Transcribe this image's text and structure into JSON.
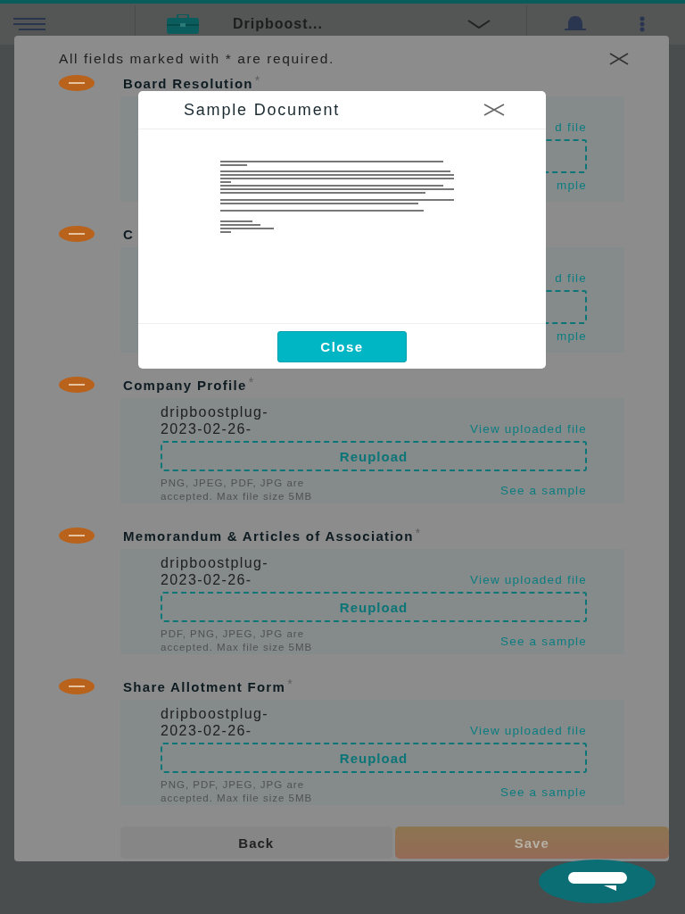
{
  "header": {
    "company": "Dripboost..."
  },
  "form": {
    "notice": "All fields marked with * are required.",
    "sections": [
      {
        "title": "Board Resolution",
        "expanded": true,
        "required_mark": "*",
        "view_link": "d file",
        "sample_link": "mple"
      },
      {
        "title": "C",
        "expanded": true,
        "view_link": "d file",
        "sample_link": "mple"
      },
      {
        "title": "Company Profile",
        "expanded": true,
        "required_mark": "*",
        "file_name_lines": [
          "dripboostplug-",
          "2023-02-26-"
        ],
        "view_link": "View uploaded file",
        "reupload_label": "Reupload",
        "formats": "PNG, JPEG, PDF, JPG are accepted. Max file size 5MB",
        "sample_link": "See a sample"
      },
      {
        "title": "Memorandum & Articles of Association",
        "expanded": true,
        "required_mark": "*",
        "file_name_lines": [
          "dripboostplug-",
          "2023-02-26-"
        ],
        "view_link": "View uploaded file",
        "reupload_label": "Reupload",
        "formats": "PDF, PNG, JPEG, JPG are accepted. Max file size 5MB",
        "sample_link": "See a sample"
      },
      {
        "title": "Share Allotment Form",
        "expanded": true,
        "required_mark": "*",
        "file_name_lines": [
          "dripboostplug-",
          "2023-02-26-"
        ],
        "view_link": "View uploaded file",
        "reupload_label": "Reupload",
        "formats": "PNG, PDF, JPEG, JPG are accepted. Max file size 5MB",
        "sample_link": "See a sample"
      }
    ],
    "buttons": [
      {
        "label": "Back",
        "kind": "secondary"
      },
      {
        "label": "Save",
        "kind": "primary"
      }
    ]
  },
  "modal": {
    "title": "Sample Document",
    "close_label": "Close"
  }
}
